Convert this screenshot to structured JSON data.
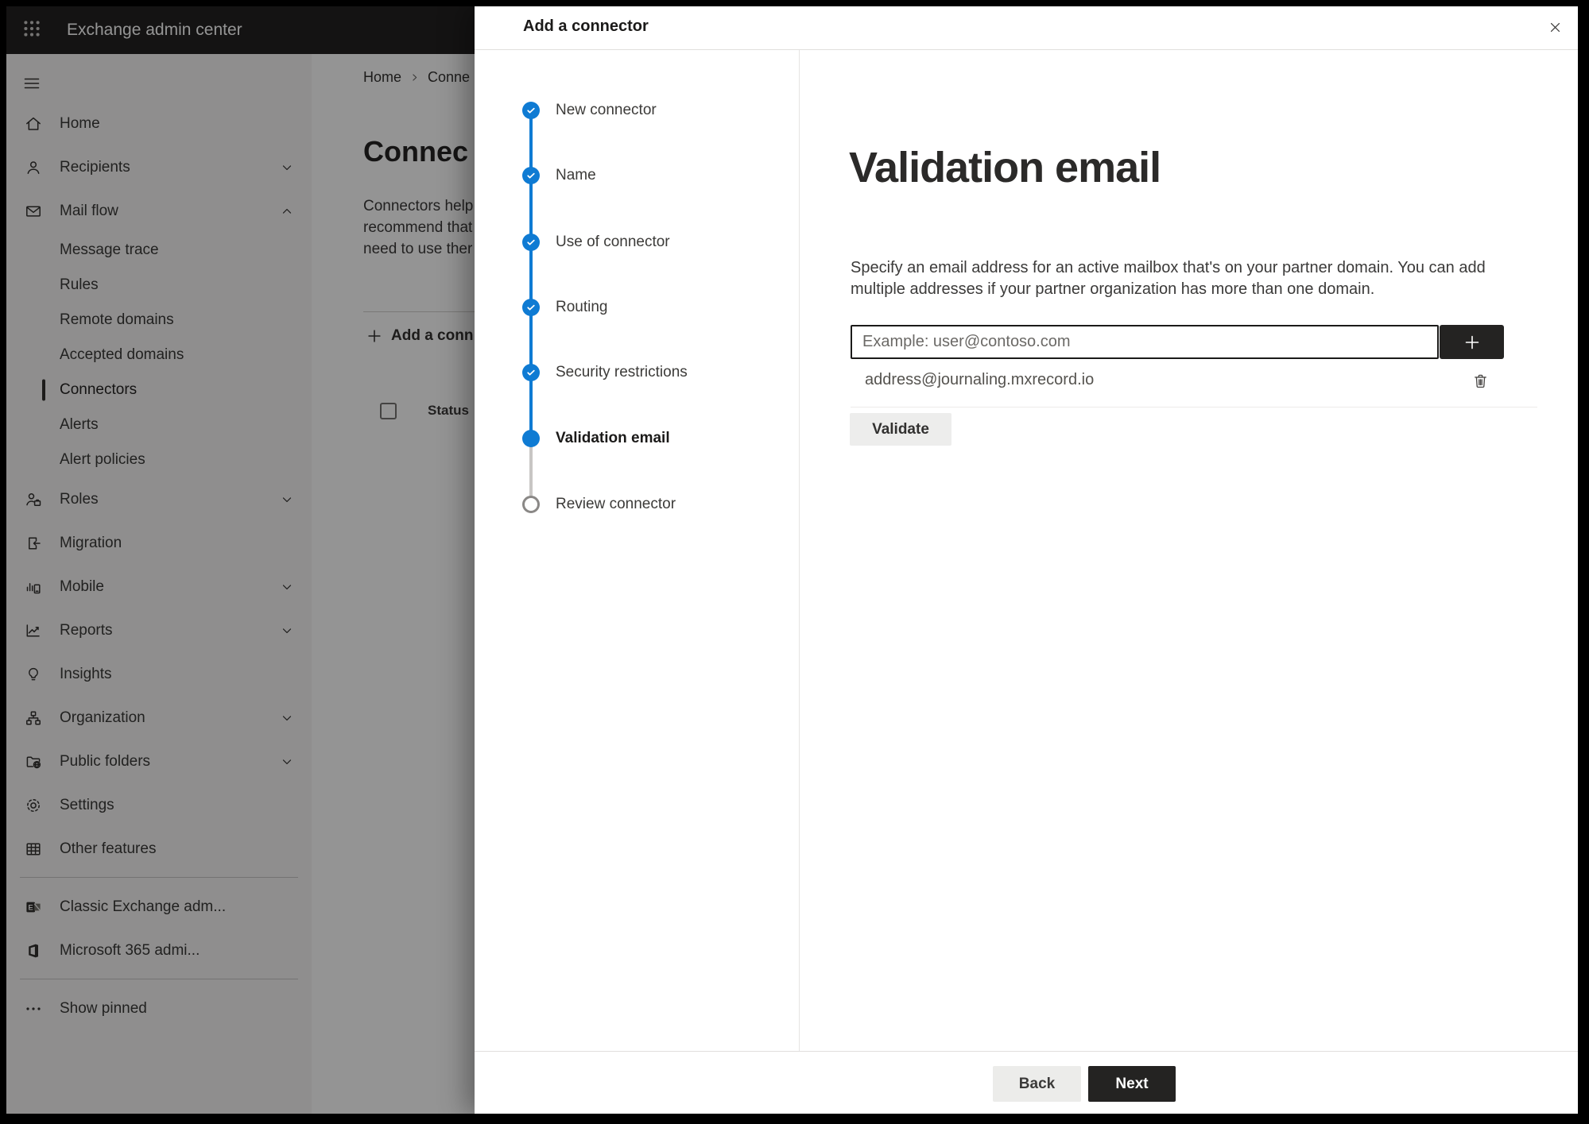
{
  "topbar": {
    "app_name": "Exchange admin center"
  },
  "sidebar": {
    "items": [
      {
        "label": "Home",
        "icon": "home",
        "kind": "main"
      },
      {
        "label": "Recipients",
        "icon": "person",
        "kind": "main",
        "chevron": "down"
      },
      {
        "label": "Mail flow",
        "icon": "mail",
        "kind": "main",
        "chevron": "up"
      },
      {
        "label": "Message trace",
        "kind": "sub"
      },
      {
        "label": "Rules",
        "kind": "sub"
      },
      {
        "label": "Remote domains",
        "kind": "sub"
      },
      {
        "label": "Accepted domains",
        "kind": "sub"
      },
      {
        "label": "Connectors",
        "kind": "sub",
        "selected": true
      },
      {
        "label": "Alerts",
        "kind": "sub"
      },
      {
        "label": "Alert policies",
        "kind": "sub"
      },
      {
        "label": "Roles",
        "icon": "roles",
        "kind": "main",
        "chevron": "down"
      },
      {
        "label": "Migration",
        "icon": "migration",
        "kind": "main"
      },
      {
        "label": "Mobile",
        "icon": "mobile",
        "kind": "main",
        "chevron": "down"
      },
      {
        "label": "Reports",
        "icon": "reports",
        "kind": "main",
        "chevron": "down"
      },
      {
        "label": "Insights",
        "icon": "insights",
        "kind": "main"
      },
      {
        "label": "Organization",
        "icon": "organization",
        "kind": "main",
        "chevron": "down"
      },
      {
        "label": "Public folders",
        "icon": "public-folders",
        "kind": "main",
        "chevron": "down"
      },
      {
        "label": "Settings",
        "icon": "settings",
        "kind": "main"
      },
      {
        "label": "Other features",
        "icon": "grid",
        "kind": "main"
      },
      {
        "kind": "divider"
      },
      {
        "label": "Classic Exchange adm...",
        "icon": "classic-exchange",
        "kind": "main"
      },
      {
        "label": "Microsoft 365 admi...",
        "icon": "m365",
        "kind": "main"
      },
      {
        "kind": "divider"
      },
      {
        "label": "Show pinned",
        "icon": "dots",
        "kind": "main"
      }
    ]
  },
  "page": {
    "breadcrumb_home": "Home",
    "breadcrumb_current": "Conne",
    "title": "Connec",
    "paragraph_lines": [
      "Connectors help",
      "recommend that",
      "need to use ther"
    ],
    "add_button_label": "Add a conn",
    "status_header": "Status"
  },
  "modal": {
    "title": "Add a connector",
    "steps": [
      {
        "label": "New connector",
        "state": "done"
      },
      {
        "label": "Name",
        "state": "done"
      },
      {
        "label": "Use of connector",
        "state": "done"
      },
      {
        "label": "Routing",
        "state": "done"
      },
      {
        "label": "Security restrictions",
        "state": "done"
      },
      {
        "label": "Validation email",
        "state": "current"
      },
      {
        "label": "Review connector",
        "state": "todo"
      }
    ],
    "content": {
      "heading": "Validation email",
      "description_lines": [
        "Specify an email address for an active mailbox that's on your partner domain. You can add",
        "multiple addresses if your partner organization has more than one domain."
      ],
      "email_placeholder": "Example: user@contoso.com",
      "added_addresses": [
        "address@journaling.mxrecord.io"
      ],
      "validate_button": "Validate"
    },
    "footer": {
      "back_label": "Back",
      "next_label": "Next"
    }
  },
  "colors": {
    "accent_blue": "#0f7bd3",
    "dark_button": "#242322",
    "done_line": "#0f7bd3",
    "todo_line": "#c8c6c4"
  }
}
